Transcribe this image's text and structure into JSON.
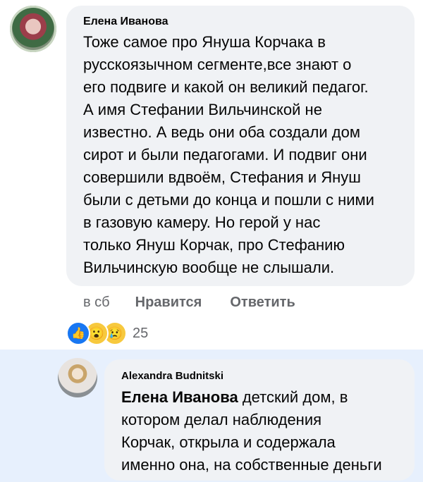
{
  "comment": {
    "author": "Елена Иванова",
    "text": "Тоже самое про Януша Корчака в\nрусскоязычном сегменте,все знают о\nего подвиге и какой он великий педагог.\nА имя Стефании Вильчинской не\nизвестно. А ведь они оба создали дом\nсирот и были педагогами. И подвиг они\nсовершили вдвоём, Стефания и Януш\nбыли с детьми до конца и пошли с ними\nв газовую камеру. Но герой у нас\nтолько Януш Корчак, про Стефанию\nВильчинскую вообще не слышали.",
    "time": "в сб",
    "like_label": "Нравится",
    "reply_label": "Ответить",
    "reaction_count": "25"
  },
  "reply": {
    "author": "Alexandra Budnitski",
    "mention": "Елена Иванова",
    "text": " детский дом, в\nкотором делал наблюдения\nКорчак, открыла и содержала\nименно она, на собственные деньги"
  },
  "reactions": [
    "like-icon",
    "wow-icon",
    "sad-icon"
  ]
}
